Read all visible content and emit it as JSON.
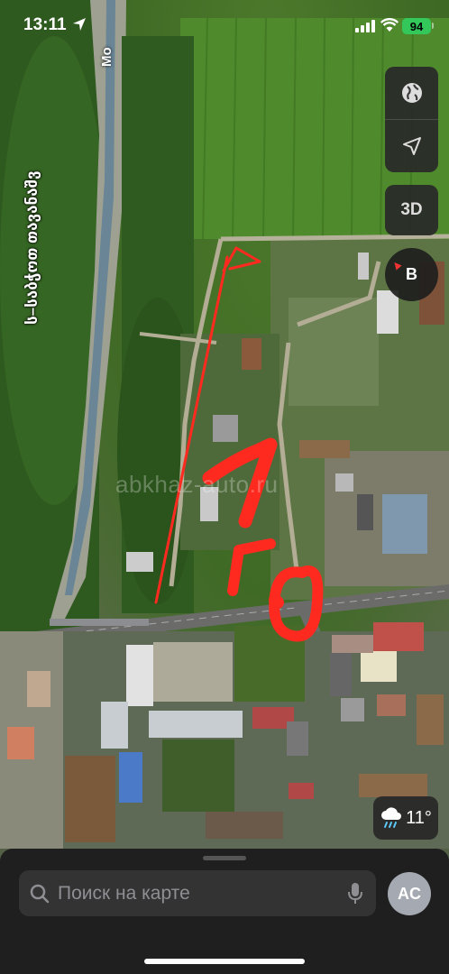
{
  "status_bar": {
    "time": "13:11",
    "battery": "94"
  },
  "map": {
    "street_label": "ს–საბჭოთ თავანაშვ",
    "street_label_2": "Мо",
    "watermark": "abkhaz-auto.ru",
    "annotation_1": "1",
    "annotation_2": "Г.О",
    "arrow_color": "#ff2a1f"
  },
  "controls": {
    "globe_icon": "globe-icon",
    "location_icon": "location-arrow-icon",
    "three_d_label": "3D",
    "compass_label": "В"
  },
  "weather": {
    "icon": "rain-cloud-icon",
    "temp": "11°"
  },
  "sheet": {
    "search_placeholder": "Поиск на карте",
    "avatar_initials": "AC"
  }
}
